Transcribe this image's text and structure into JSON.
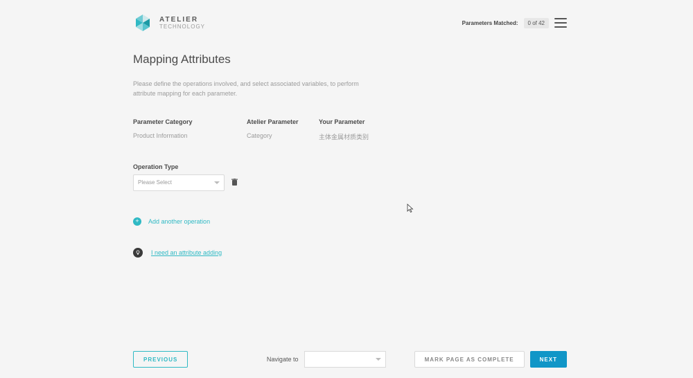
{
  "brand": {
    "line1": "ATELIER",
    "line2": "TECHNOLOGY"
  },
  "header": {
    "params_matched_label": "Parameters Matched:",
    "params_matched_badge": "0 of 42"
  },
  "page": {
    "title": "Mapping Attributes",
    "description": "Please define the operations involved, and select associated variables, to perform attribute mapping for each parameter."
  },
  "columns": {
    "parameter_category": {
      "head": "Parameter Category",
      "value": "Product Information"
    },
    "atelier_parameter": {
      "head": "Atelier Parameter",
      "value": "Category"
    },
    "your_parameter": {
      "head": "Your Parameter",
      "value": "主体金属材质类别"
    }
  },
  "operation": {
    "label": "Operation Type",
    "placeholder": "Please Select"
  },
  "links": {
    "add_another": "Add another operation",
    "need_attribute": "I need an attribute adding"
  },
  "footer": {
    "previous": "PREVIOUS",
    "navigate_label": "Navigate to",
    "mark_complete": "MARK PAGE AS COMPLETE",
    "next": "NEXT"
  }
}
